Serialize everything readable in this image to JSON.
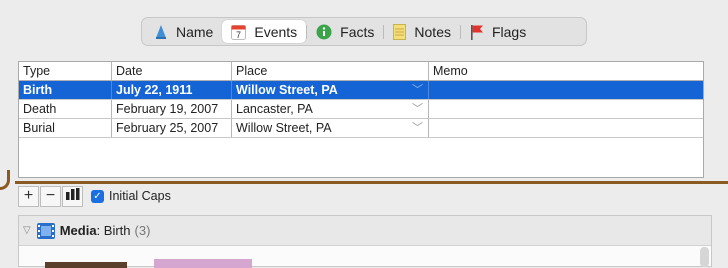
{
  "tabs": [
    {
      "label": "Name",
      "icon": "person-icon",
      "active": false
    },
    {
      "label": "Events",
      "icon": "calendar-icon",
      "active": true,
      "icon_text": "7"
    },
    {
      "label": "Facts",
      "icon": "info-icon",
      "active": false
    },
    {
      "label": "Notes",
      "icon": "notepad-icon",
      "active": false
    },
    {
      "label": "Flags",
      "icon": "flag-icon",
      "active": false
    }
  ],
  "table": {
    "columns": [
      "Type",
      "Date",
      "Place",
      "Memo"
    ],
    "rows": [
      {
        "type": "Birth",
        "date": "July 22, 1911",
        "place": "Willow Street, PA",
        "memo": "",
        "selected": true
      },
      {
        "type": "Death",
        "date": "February 19, 2007",
        "place": "Lancaster, PA",
        "memo": "",
        "selected": false
      },
      {
        "type": "Burial",
        "date": "February 25, 2007",
        "place": "Willow Street, PA",
        "memo": "",
        "selected": false
      }
    ]
  },
  "toolbar": {
    "add_label": "+",
    "remove_label": "−",
    "initial_caps_label": "Initial Caps",
    "initial_caps_checked": true
  },
  "media": {
    "label": "Media",
    "subject": ": Birth",
    "count": "(3)"
  },
  "colors": {
    "selection": "#1464d6",
    "annotation_line": "#8a5a22",
    "checkbox": "#1b6fe0"
  }
}
